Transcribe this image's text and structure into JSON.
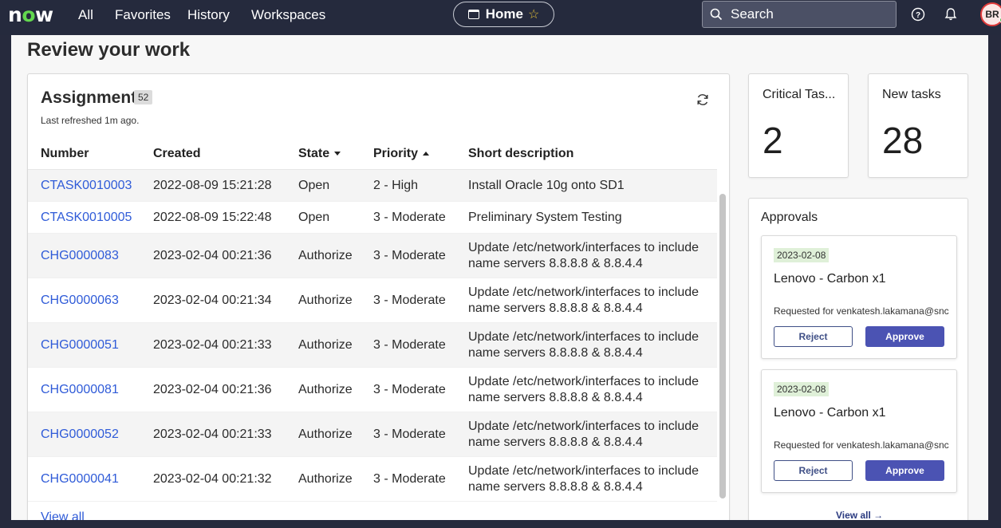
{
  "nav": {
    "logo": "now",
    "links": [
      "All",
      "Favorites",
      "History",
      "Workspaces"
    ],
    "home_label": "Home",
    "search_placeholder": "Search",
    "avatar_initials": "BR"
  },
  "page": {
    "title": "Review your work"
  },
  "assignments": {
    "title": "Assignments",
    "count": "52",
    "last_refreshed": "Last refreshed 1m ago.",
    "columns": [
      "Number",
      "Created",
      "State",
      "Priority",
      "Short description"
    ],
    "rows": [
      {
        "number": "CTASK0010003",
        "created": "2022-08-09 15:21:28",
        "state": "Open",
        "priority": "2 - High",
        "desc": "Install Oracle 10g onto SD1"
      },
      {
        "number": "CTASK0010005",
        "created": "2022-08-09 15:22:48",
        "state": "Open",
        "priority": "3 - Moderate",
        "desc": "Preliminary System Testing"
      },
      {
        "number": "CHG0000083",
        "created": "2023-02-04 00:21:36",
        "state": "Authorize",
        "priority": "3 - Moderate",
        "desc": "Update /etc/network/interfaces to include name servers 8.8.8.8 & 8.8.4.4"
      },
      {
        "number": "CHG0000063",
        "created": "2023-02-04 00:21:34",
        "state": "Authorize",
        "priority": "3 - Moderate",
        "desc": "Update /etc/network/interfaces to include name servers 8.8.8.8 & 8.8.4.4"
      },
      {
        "number": "CHG0000051",
        "created": "2023-02-04 00:21:33",
        "state": "Authorize",
        "priority": "3 - Moderate",
        "desc": "Update /etc/network/interfaces to include name servers 8.8.8.8 & 8.8.4.4"
      },
      {
        "number": "CHG0000081",
        "created": "2023-02-04 00:21:36",
        "state": "Authorize",
        "priority": "3 - Moderate",
        "desc": "Update /etc/network/interfaces to include name servers 8.8.8.8 & 8.8.4.4"
      },
      {
        "number": "CHG0000052",
        "created": "2023-02-04 00:21:33",
        "state": "Authorize",
        "priority": "3 - Moderate",
        "desc": "Update /etc/network/interfaces to include name servers 8.8.8.8 & 8.8.4.4"
      },
      {
        "number": "CHG0000041",
        "created": "2023-02-04 00:21:32",
        "state": "Authorize",
        "priority": "3 - Moderate",
        "desc": "Update /etc/network/interfaces to include name servers 8.8.8.8 & 8.8.4.4"
      }
    ],
    "view_all": "View all"
  },
  "stats": [
    {
      "label": "Critical Tas...",
      "value": "2"
    },
    {
      "label": "New tasks",
      "value": "28"
    }
  ],
  "approvals": {
    "title": "Approvals",
    "items": [
      {
        "date": "2023-02-08",
        "name": "Lenovo - Carbon x1",
        "requested": "Requested for venkatesh.lakamana@snc",
        "reject": "Reject",
        "approve": "Approve"
      },
      {
        "date": "2023-02-08",
        "name": "Lenovo - Carbon x1",
        "requested": "Requested for venkatesh.lakamana@snc",
        "reject": "Reject",
        "approve": "Approve"
      }
    ],
    "view_all": "View all →"
  },
  "colors": {
    "nav_bg": "#252a3d",
    "link": "#2f5bd8",
    "approve": "#4b53b3",
    "date_badge": "#dff0d8",
    "logo_accent": "#62d84e"
  }
}
